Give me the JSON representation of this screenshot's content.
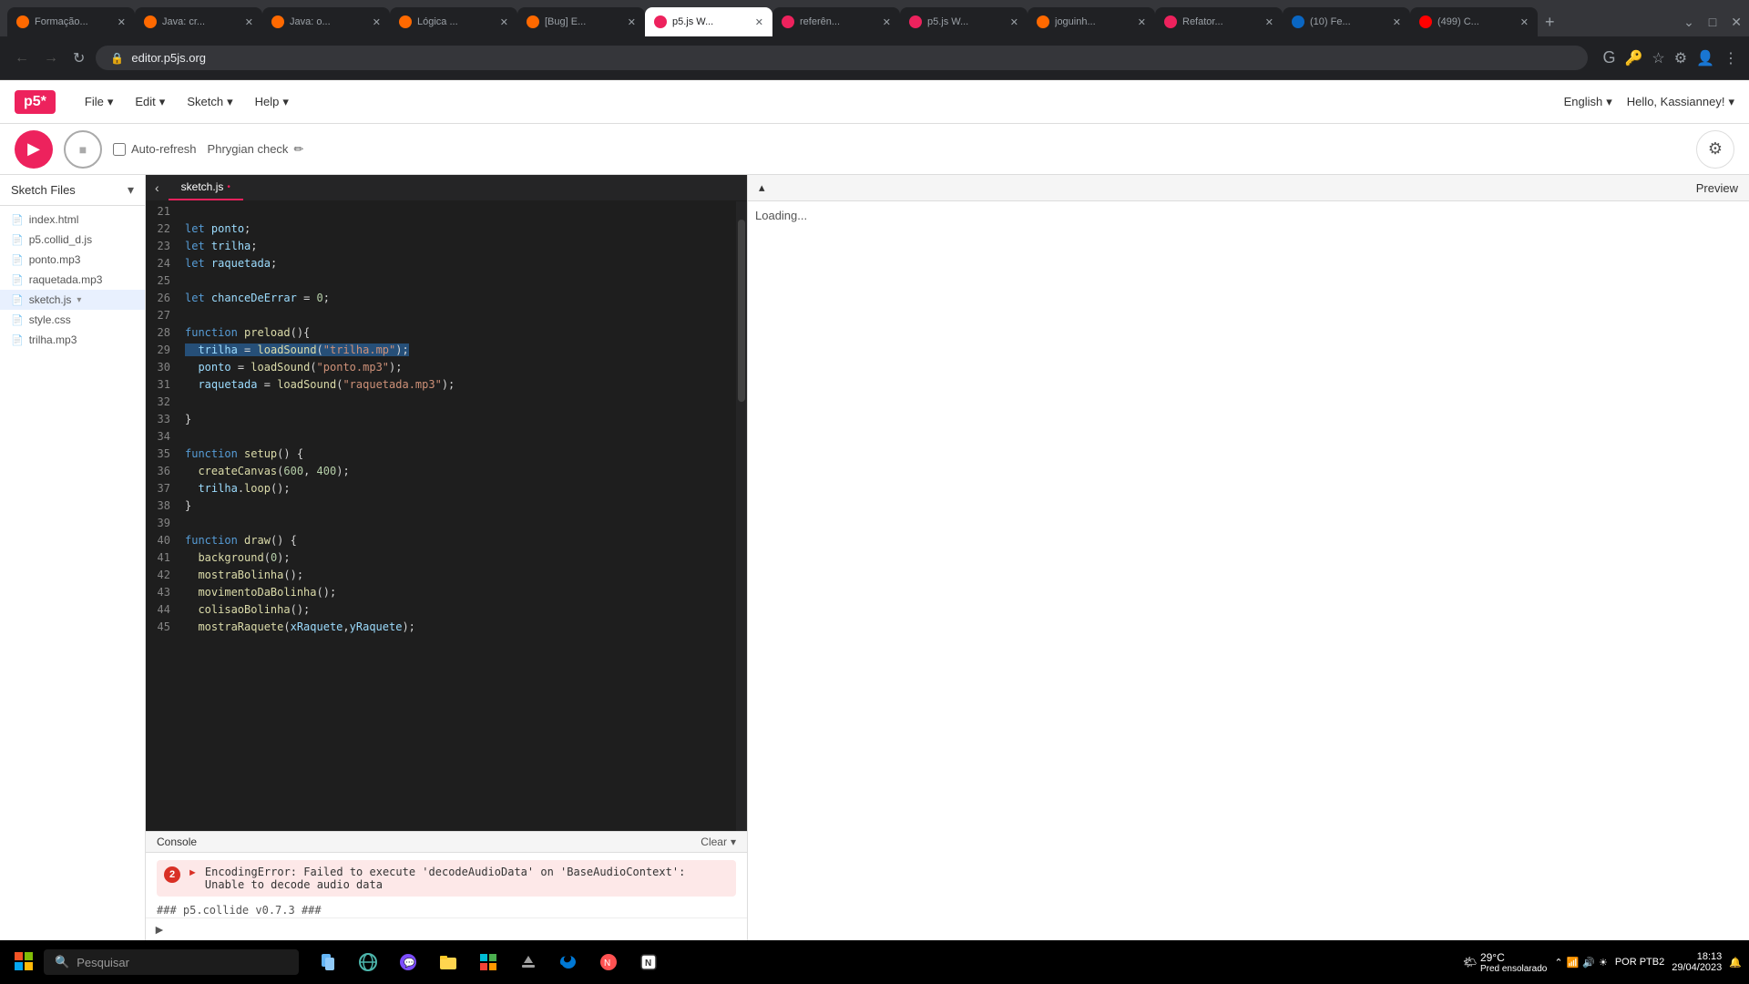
{
  "browser": {
    "tabs": [
      {
        "id": 1,
        "title": "Formação...",
        "active": false,
        "favicon_color": "#ff6900"
      },
      {
        "id": 2,
        "title": "Java: cr...",
        "active": false,
        "favicon_color": "#ff6900"
      },
      {
        "id": 3,
        "title": "Java: o...",
        "active": false,
        "favicon_color": "#ff6900"
      },
      {
        "id": 4,
        "title": "Lógica ...",
        "active": false,
        "favicon_color": "#ff6900"
      },
      {
        "id": 5,
        "title": "[Bug] E...",
        "active": false,
        "favicon_color": "#ff6900"
      },
      {
        "id": 6,
        "title": "p5.js W...",
        "active": true,
        "favicon_color": "#ed225d"
      },
      {
        "id": 7,
        "title": "referên...",
        "active": false,
        "favicon_color": "#ed225d"
      },
      {
        "id": 8,
        "title": "p5.js W...",
        "active": false,
        "favicon_color": "#ed225d"
      },
      {
        "id": 9,
        "title": "joguinh...",
        "active": false,
        "favicon_color": "#ff6900"
      },
      {
        "id": 10,
        "title": "Refator...",
        "active": false,
        "favicon_color": "#ed225d"
      },
      {
        "id": 11,
        "title": "(10) Fe...",
        "active": false,
        "favicon_color": "#0a66c2"
      },
      {
        "id": 12,
        "title": "(499) C...",
        "active": false,
        "favicon_color": "#ff0000"
      }
    ],
    "url": "editor.p5js.org"
  },
  "app": {
    "logo": "p5*",
    "menu": [
      "File",
      "Edit",
      "Sketch",
      "Help"
    ],
    "language": "English",
    "user": "Hello, Kassianney!"
  },
  "toolbar": {
    "play_label": "▶",
    "stop_label": "■",
    "auto_refresh_label": "Auto-refresh",
    "sketch_name": "Phrygian check",
    "edit_icon": "✏"
  },
  "sidebar": {
    "title": "Sketch Files",
    "files": [
      {
        "name": "index.html",
        "type": "file",
        "icon": "📄"
      },
      {
        "name": "p5.collid_d.js",
        "type": "file",
        "icon": "📄"
      },
      {
        "name": "ponto.mp3",
        "type": "file",
        "icon": "📄"
      },
      {
        "name": "raquetada.mp3",
        "type": "file",
        "icon": "📄"
      },
      {
        "name": "sketch.js",
        "type": "file",
        "icon": "📄",
        "active": true,
        "arrow": true
      },
      {
        "name": "style.css",
        "type": "file",
        "icon": "📄"
      },
      {
        "name": "trilha.mp3",
        "type": "file",
        "icon": "📄"
      }
    ]
  },
  "editor": {
    "tab_name": "sketch.js",
    "unsaved": true,
    "lines": [
      {
        "num": 21,
        "code": ""
      },
      {
        "num": 22,
        "code": "let ponto;"
      },
      {
        "num": 23,
        "code": "let trilha;"
      },
      {
        "num": 24,
        "code": "let raquetada;"
      },
      {
        "num": 25,
        "code": ""
      },
      {
        "num": 26,
        "code": "let chanceDeErrar = 0;"
      },
      {
        "num": 27,
        "code": ""
      },
      {
        "num": 28,
        "code": "function preload(){"
      },
      {
        "num": 29,
        "code": "  trilha = loadSound(\"trilha.mp\");",
        "highlight": true
      },
      {
        "num": 30,
        "code": "  ponto = loadSound(\"ponto.mp3\");"
      },
      {
        "num": 31,
        "code": "  raquetada = loadSound(\"raquetada.mp3\");"
      },
      {
        "num": 32,
        "code": ""
      },
      {
        "num": 33,
        "code": "}"
      },
      {
        "num": 34,
        "code": ""
      },
      {
        "num": 35,
        "code": "function setup() {",
        "arrow": true
      },
      {
        "num": 36,
        "code": "  createCanvas(600, 400);"
      },
      {
        "num": 37,
        "code": "  trilha.loop();"
      },
      {
        "num": 38,
        "code": "}"
      },
      {
        "num": 39,
        "code": ""
      },
      {
        "num": 40,
        "code": "function draw() {",
        "arrow": true
      },
      {
        "num": 41,
        "code": "  background(0);"
      },
      {
        "num": 42,
        "code": "  mostraBolinha();"
      },
      {
        "num": 43,
        "code": "  movimentoDaBolinha();"
      },
      {
        "num": 44,
        "code": "  colisaoBolinha();"
      },
      {
        "num": 45,
        "code": "  mostraRaquete(xRaquete,yRaquete);"
      }
    ]
  },
  "console": {
    "title": "Console",
    "clear_label": "Clear",
    "error": {
      "count": "2",
      "message": "EncodingError: Failed to execute 'decodeAudioData' on\n'BaseAudioContext': Unable to decode audio data"
    },
    "info": "### p5.collide v0.7.3 ###"
  },
  "preview": {
    "title": "Preview",
    "status": "Loading..."
  },
  "taskbar": {
    "search_placeholder": "Pesquisar",
    "time": "18:13",
    "date": "29/04/2023",
    "lang": "POR\nPTB2",
    "temp": "29°C",
    "location": "Pred ensolarado"
  }
}
